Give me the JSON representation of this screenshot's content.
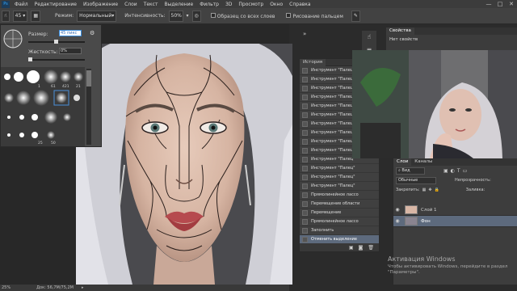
{
  "menu": {
    "logo": "Ps",
    "items": [
      "Файл",
      "Редактирование",
      "Изображение",
      "Слои",
      "Текст",
      "Выделение",
      "Фильтр",
      "3D",
      "Просмотр",
      "Окно",
      "Справка"
    ]
  },
  "window_controls": [
    "—",
    "□",
    "✕"
  ],
  "options": {
    "brush_size": "45",
    "mode_label": "Режим:",
    "mode_value": "Нормальный",
    "intensity_label": "Интенсивность:",
    "intensity_value": "50%",
    "all_layers_label": "Образец со всех слоев",
    "finger_label": "Рисование пальцем"
  },
  "brush_panel": {
    "size_label": "Размер:",
    "size_value": "45 пикс",
    "hardness_label": "Жесткость:",
    "hardness_value": "0%",
    "preset_labels": [
      "1",
      "61",
      "421",
      "21",
      "25",
      "50"
    ]
  },
  "status": {
    "zoom": "25%",
    "doc": "Док: 56,7M/75,2M"
  },
  "history": {
    "title": "История",
    "items": [
      "Инструмент \"Палец\"",
      "Инструмент \"Палец\"",
      "Инструмент \"Палец\"",
      "Инструмент \"Палец\"",
      "Инструмент \"Палец\"",
      "Инструмент \"Палец\"",
      "Инструмент \"Палец\"",
      "Инструмент \"Палец\"",
      "Инструмент \"Палец\"",
      "Инструмент \"Палец\"",
      "Инструмент \"Палец\"",
      "Инструмент \"Палец\"",
      "Инструмент \"Палец\"",
      "Инструмент \"Палец\"",
      "Прямолинейное лассо",
      "Перемещение области",
      "Перемещение",
      "Прямолинейное лассо",
      "Заполнить",
      "Отменить выделение"
    ]
  },
  "properties": {
    "tab": "Свойства",
    "empty": "Нет свойств"
  },
  "layers": {
    "tabs": [
      "Слои",
      "Каналы"
    ],
    "filter": "Вид",
    "blend": "Обычные",
    "opacity_label": "Непрозрачность:",
    "lock_label": "Закрепить:",
    "fill_label": "Заливка:",
    "rows": [
      {
        "name": "Слой 1"
      },
      {
        "name": "Фон"
      }
    ]
  },
  "activation": {
    "title": "Активация Windows",
    "text": "Чтобы активировать Windows, перейдите в раздел \"Параметры\"."
  },
  "colors": {
    "accent": "#31a8ff",
    "selected_row": "#5d6a7d"
  }
}
